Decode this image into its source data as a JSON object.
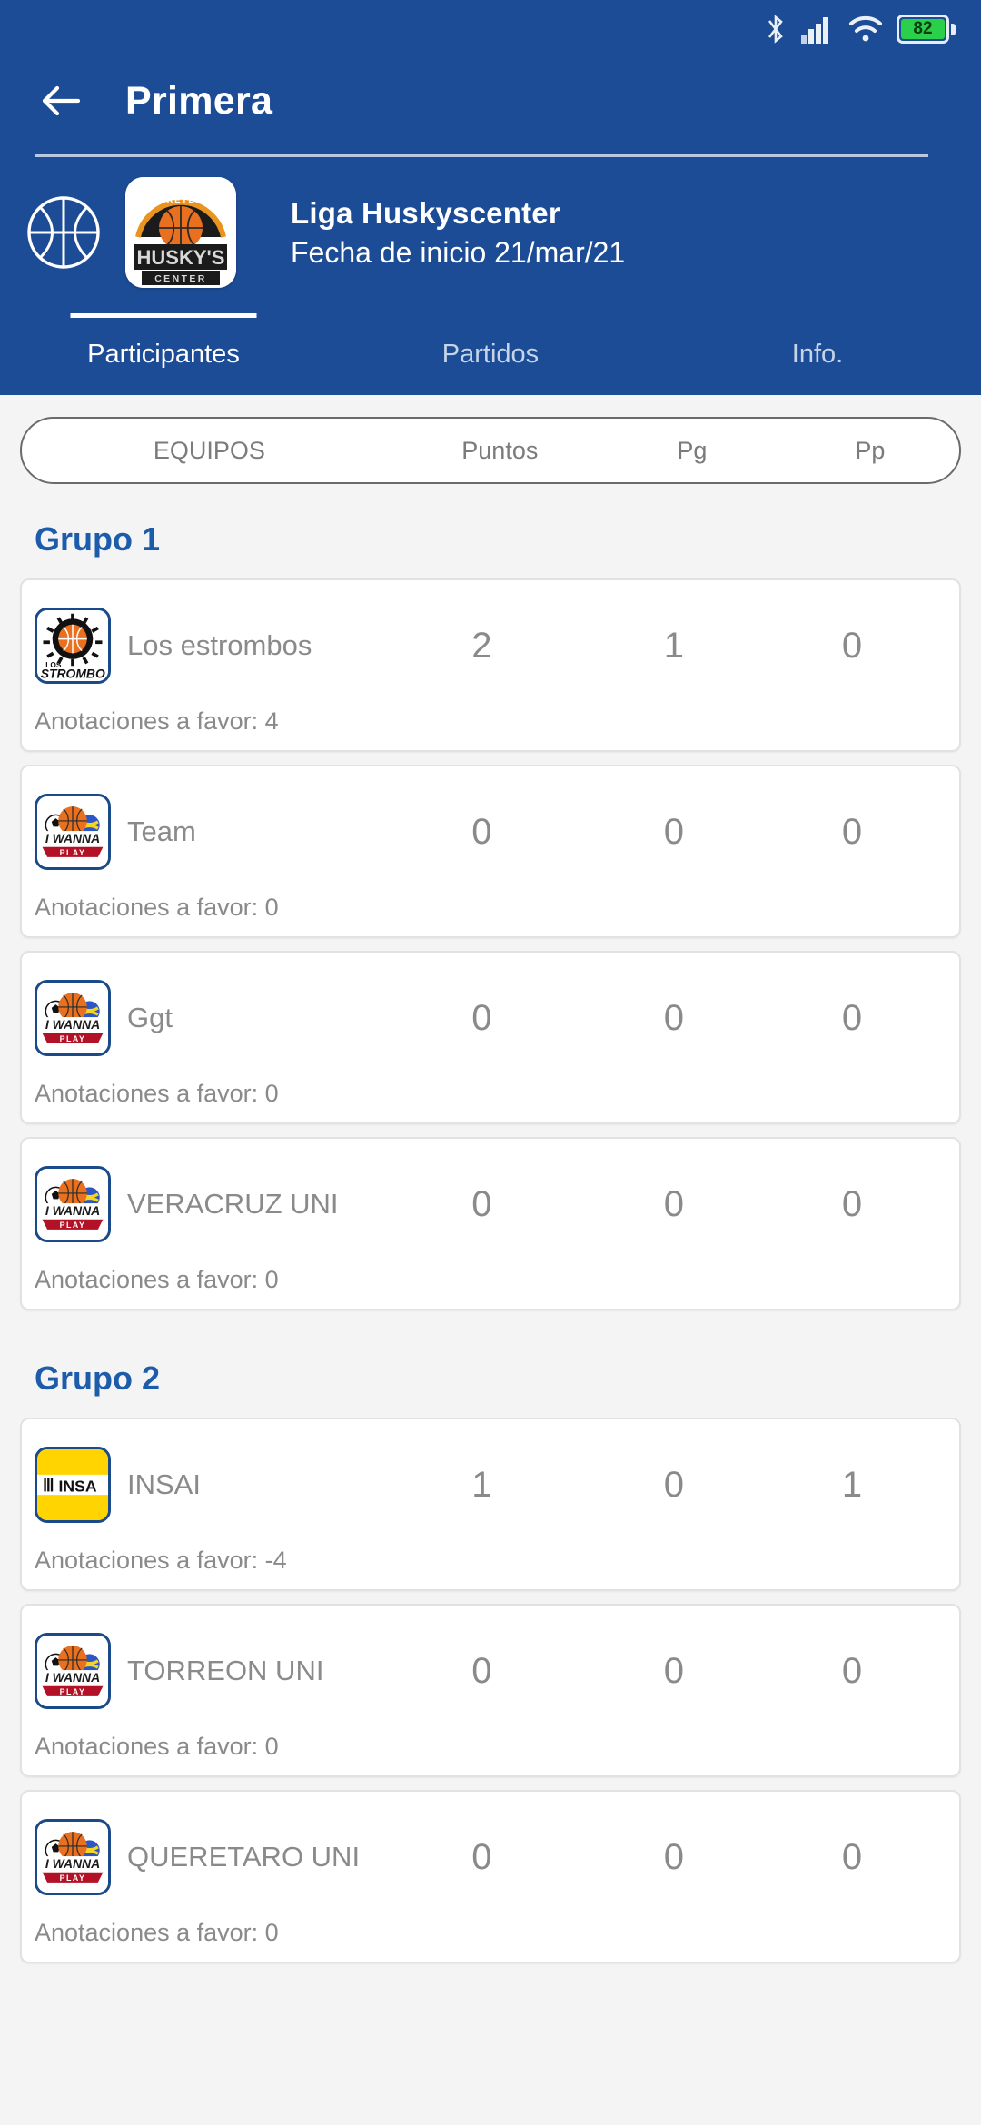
{
  "statusbar": {
    "bluetooth_icon": "bluetooth-icon",
    "signal_icon": "cellular-signal-icon",
    "wifi_icon": "wifi-icon",
    "battery_icon": "battery-icon",
    "battery_level": "82"
  },
  "appbar": {
    "back_icon": "back-arrow-icon",
    "title": "Primera",
    "accent_color": "#1d4c96"
  },
  "league": {
    "sport_icon": "basketball-icon",
    "logo_icon": "huskys-center-logo",
    "name": "Liga Huskyscenter",
    "date_label": "Fecha de inicio  21/mar/21"
  },
  "tabs": [
    {
      "label": "Participantes",
      "active": true
    },
    {
      "label": "Partidos",
      "active": false
    },
    {
      "label": "Info.",
      "active": false
    }
  ],
  "columns": {
    "team": "EQUIPOS",
    "points": "Puntos",
    "won": "Pg",
    "lost": "Pp"
  },
  "groups": [
    {
      "title": "Grupo 1",
      "teams": [
        {
          "logo": "los-strombos-logo",
          "name": "Los estrombos",
          "points": "2",
          "won": "1",
          "lost": "0",
          "footer": "Anotaciones a favor: 4"
        },
        {
          "logo": "i-wanna-play-logo",
          "name": "Team",
          "points": "0",
          "won": "0",
          "lost": "0",
          "footer": "Anotaciones a favor: 0"
        },
        {
          "logo": "i-wanna-play-logo",
          "name": "Ggt",
          "points": "0",
          "won": "0",
          "lost": "0",
          "footer": "Anotaciones a favor: 0"
        },
        {
          "logo": "i-wanna-play-logo",
          "name": "VERACRUZ UNI",
          "points": "0",
          "won": "0",
          "lost": "0",
          "footer": "Anotaciones a favor: 0"
        }
      ]
    },
    {
      "title": "Grupo 2",
      "teams": [
        {
          "logo": "insai-logo",
          "name": "INSAI",
          "points": "1",
          "won": "0",
          "lost": "1",
          "footer": "Anotaciones a favor: -4"
        },
        {
          "logo": "i-wanna-play-logo",
          "name": "TORREON UNI",
          "points": "0",
          "won": "0",
          "lost": "0",
          "footer": "Anotaciones a favor: 0"
        },
        {
          "logo": "i-wanna-play-logo",
          "name": "QUERETARO UNI",
          "points": "0",
          "won": "0",
          "lost": "0",
          "footer": "Anotaciones a favor: 0"
        }
      ]
    }
  ],
  "colors": {
    "primary_blue": "#1d4c96",
    "group_heading": "#1c5cab",
    "muted_text": "#8a8a8a",
    "page_bg": "#f4f4f4"
  }
}
